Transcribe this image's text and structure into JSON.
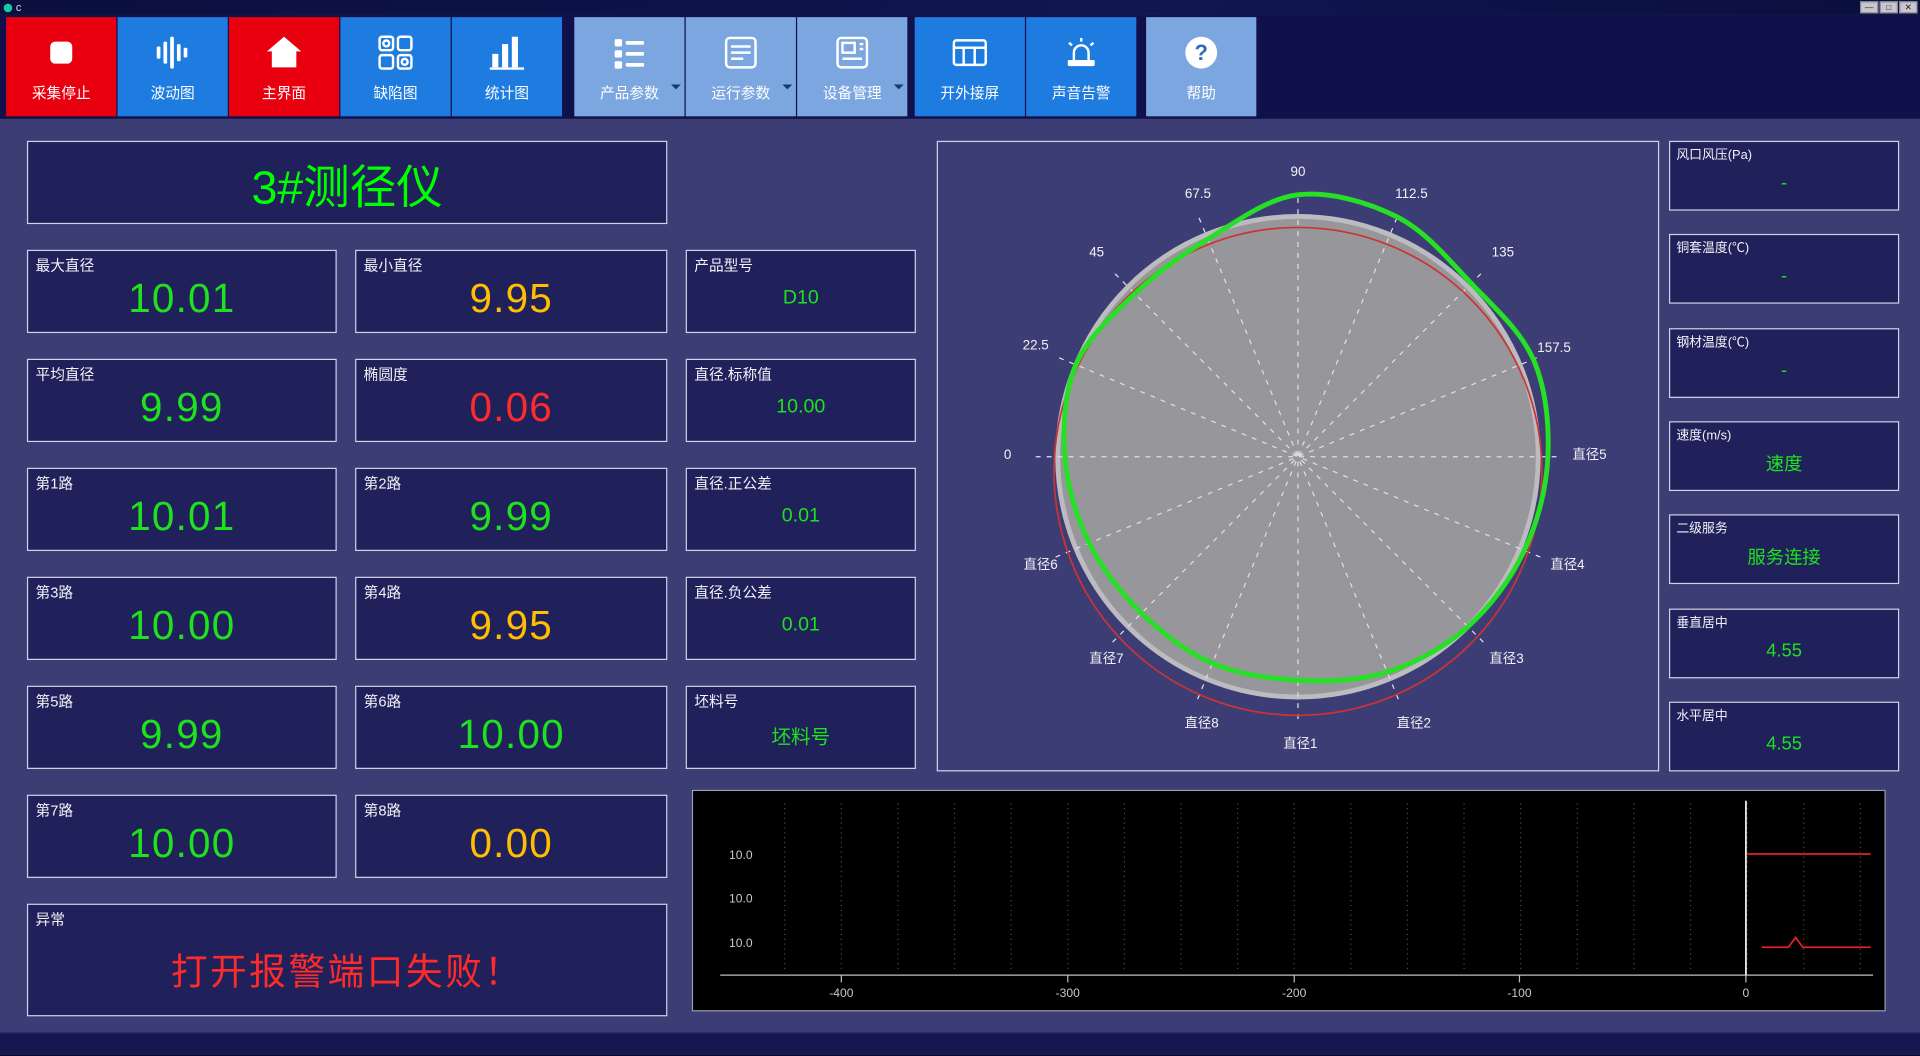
{
  "window": {
    "title": "c",
    "min": "—",
    "max": "□",
    "close": "✕"
  },
  "toolbar": {
    "buttons": [
      {
        "label": "采集停止"
      },
      {
        "label": "波动图"
      },
      {
        "label": "主界面"
      },
      {
        "label": "缺陷图"
      },
      {
        "label": "统计图"
      },
      {
        "label": "产品参数"
      },
      {
        "label": "运行参数"
      },
      {
        "label": "设备管理"
      },
      {
        "label": "开外接屏"
      },
      {
        "label": "声音告警"
      },
      {
        "label": "帮助"
      }
    ]
  },
  "panel_title": "3#测径仪",
  "cells": [
    {
      "label": "最大直径",
      "value": "10.01",
      "color": "green"
    },
    {
      "label": "最小直径",
      "value": "9.95",
      "color": "yellow"
    },
    {
      "label": "产品型号",
      "value": "D10",
      "color": "green"
    },
    {
      "label": "平均直径",
      "value": "9.99",
      "color": "green"
    },
    {
      "label": "椭圆度",
      "value": "0.06",
      "color": "red"
    },
    {
      "label": "直径.标称值",
      "value": "10.00",
      "color": "green"
    },
    {
      "label": "第1路",
      "value": "10.01",
      "color": "green"
    },
    {
      "label": "第2路",
      "value": "9.99",
      "color": "green"
    },
    {
      "label": "直径.正公差",
      "value": "0.01",
      "color": "green"
    },
    {
      "label": "第3路",
      "value": "10.00",
      "color": "green"
    },
    {
      "label": "第4路",
      "value": "9.95",
      "color": "yellow"
    },
    {
      "label": "直径.负公差",
      "value": "0.01",
      "color": "green"
    },
    {
      "label": "第5路",
      "value": "9.99",
      "color": "green"
    },
    {
      "label": "第6路",
      "value": "10.00",
      "color": "green"
    },
    {
      "label": "坯料号",
      "value": "坯料号",
      "color": "green"
    },
    {
      "label": "第7路",
      "value": "10.00",
      "color": "green"
    },
    {
      "label": "第8路",
      "value": "0.00",
      "color": "yellow"
    }
  ],
  "alarm": {
    "label": "异常",
    "message": "打开报警端口失败！"
  },
  "polar": {
    "labels": {
      "a90": "90",
      "a675": "67.5",
      "a1125": "112.5",
      "a45": "45",
      "a135": "135",
      "a225": "22.5",
      "a1575": "157.5",
      "a0": "0",
      "d1": "直径1",
      "d2": "直径2",
      "d3": "直径3",
      "d4": "直径4",
      "d5": "直径5",
      "d6": "直径6",
      "d7": "直径7",
      "d8": "直径8"
    },
    "profile": [
      1.04,
      1.06,
      1.02,
      1.08,
      1.09,
      0.98,
      0.96,
      1.0,
      0.97,
      0.94,
      0.92,
      0.93,
      0.93,
      0.97,
      1.0,
      1.02
    ]
  },
  "right_panels": [
    {
      "label": "风口风压(Pa)",
      "value": "-"
    },
    {
      "label": "铜套温度(℃)",
      "value": "-"
    },
    {
      "label": "钢材温度(℃)",
      "value": "-"
    },
    {
      "label": "速度(m/s)",
      "value": "速度"
    },
    {
      "label": "二级服务",
      "value": "服务连接"
    },
    {
      "label": "垂直居中",
      "value": "4.55"
    },
    {
      "label": "水平居中",
      "value": "4.55"
    }
  ],
  "trend": {
    "y_labels": [
      "10.0",
      "10.0",
      "10.0"
    ],
    "x_labels": [
      "-400",
      "-300",
      "-200",
      "-100",
      "0"
    ]
  },
  "colors": {
    "green": "#1de21d",
    "yellow": "#ffbe00",
    "red": "#ff2a2a",
    "accent_blue": "#1e7ce0",
    "accent_red": "#e8000f"
  }
}
